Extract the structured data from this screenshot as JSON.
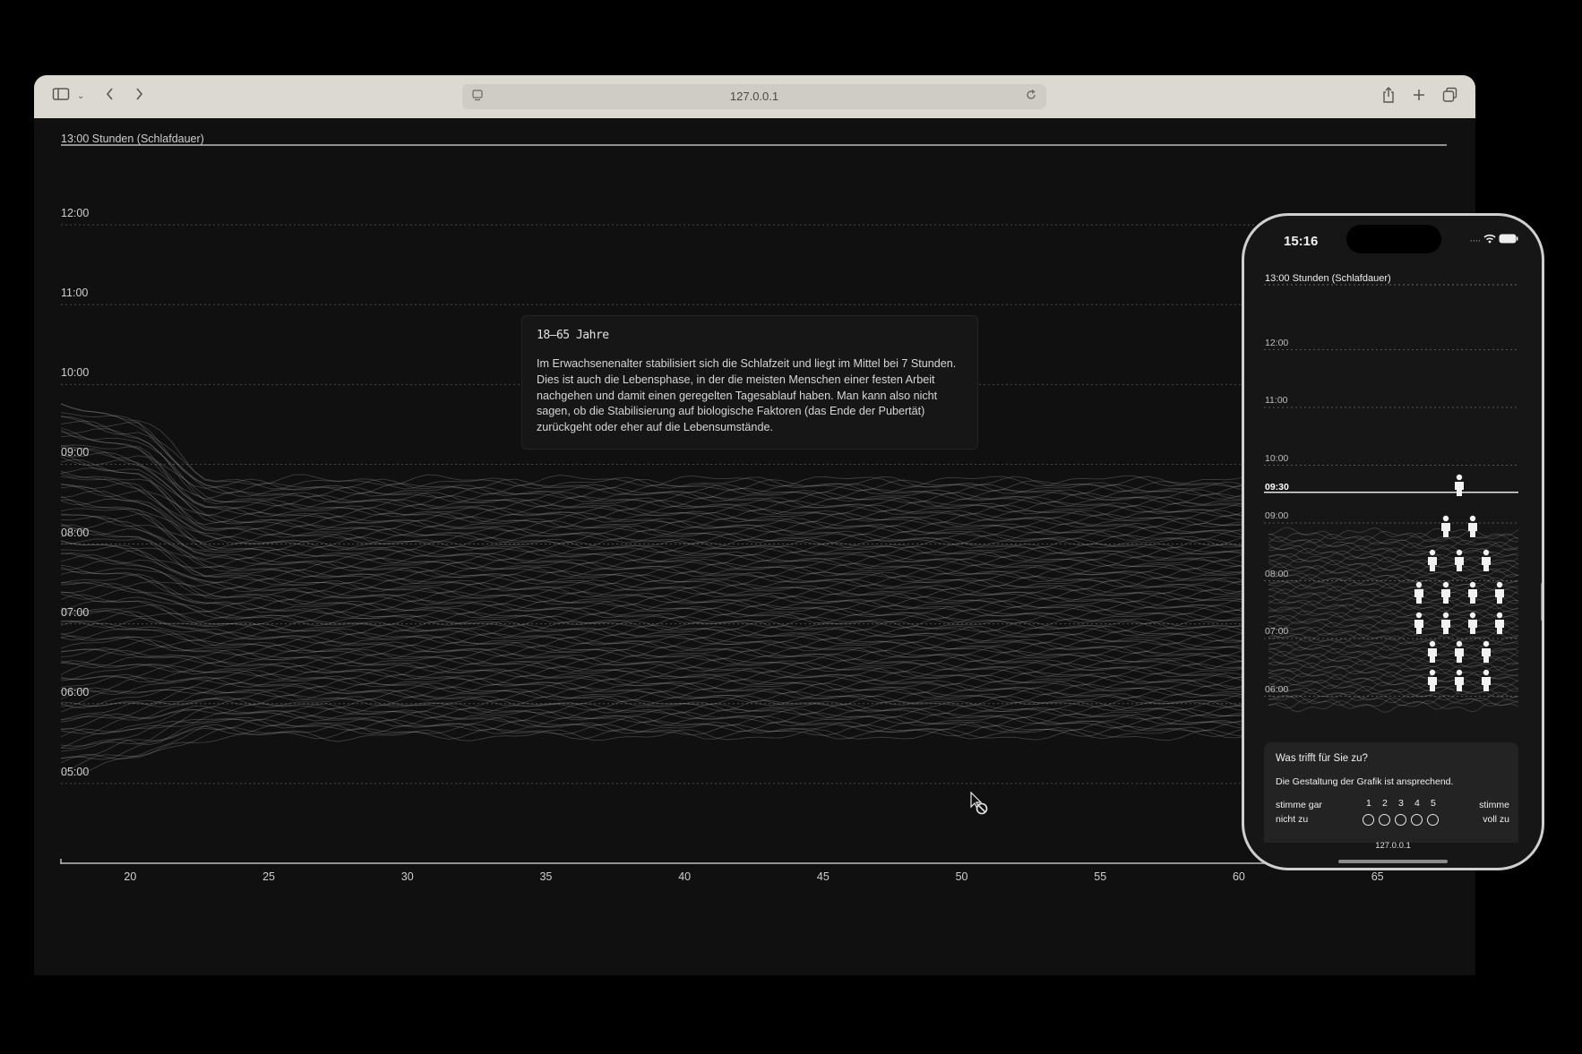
{
  "browser": {
    "url": "127.0.0.1",
    "icons": [
      "sidebar-icon",
      "chevron-down-icon",
      "back-icon",
      "forward-icon",
      "site-info-icon",
      "reload-icon",
      "share-icon",
      "new-tab-icon",
      "tabs-overview-icon"
    ]
  },
  "chart": {
    "top_label": "13:00 Stunden (Schlafdauer)",
    "y_ticks": [
      "12:00",
      "11:00",
      "10:00",
      "09:00",
      "08:00",
      "07:00",
      "06:00",
      "05:00"
    ],
    "x_ticks": [
      "20",
      "25",
      "30",
      "35",
      "40",
      "45",
      "50",
      "55",
      "60",
      "65"
    ]
  },
  "chart_data": {
    "type": "line",
    "xlabel": "",
    "ylabel": "",
    "xlim": [
      17.5,
      67.5
    ],
    "ylim": [
      4.0,
      13.0
    ],
    "y_band_at_x20": [
      5.3,
      9.6
    ],
    "y_band_at_x25_to_67": [
      5.6,
      8.8
    ],
    "series_count": 100
  },
  "info_panel": {
    "title": "18–65 Jahre",
    "text": "Im Erwachsenenalter stabilisiert sich die Schlafzeit und liegt im Mittel bei 7 Stunden. Dies ist auch die Lebensphase, in der die meisten Menschen einer festen Arbeit nachgehen und damit einen geregelten Tagesablauf haben. Man kann also nicht sagen, ob die Stabilisierung auf biologische Faktoren (das Ende der Pubertät) zurückgeht oder eher auf die Lebensumstände."
  },
  "phone": {
    "time": "15:16",
    "chart_title": "13:00 Stunden (Schlafdauer)",
    "y_ticks": [
      "12:00",
      "11:00",
      "10:00",
      "09:30",
      "09:00",
      "08:00",
      "07:00",
      "06:00"
    ],
    "selected_value": "09:30",
    "figure_rows": [
      1,
      2,
      3,
      4,
      4,
      3,
      3
    ],
    "url": "127.0.0.1",
    "survey": {
      "question": "Was trifft für Sie zu?",
      "statement": "Die Gestaltung der Grafik ist ansprechend.",
      "left_label": "stimme gar nicht zu",
      "right_label": "stimme voll zu",
      "scale": [
        "1",
        "2",
        "3",
        "4",
        "5"
      ]
    }
  }
}
